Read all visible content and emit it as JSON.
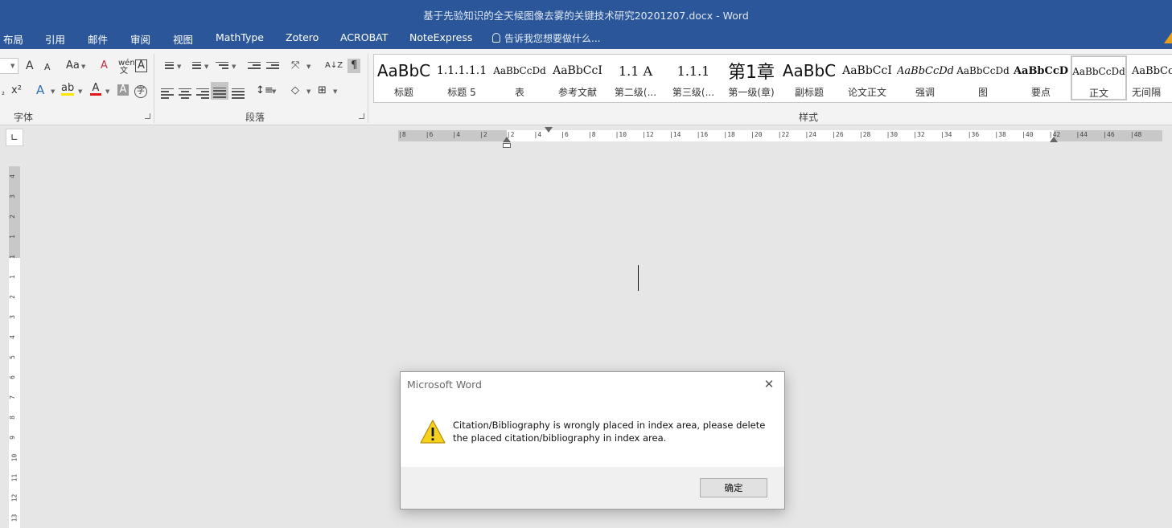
{
  "window": {
    "title": "基于先验知识的全天候图像去雾的关键技术研究20201207.docx - Word"
  },
  "tabs": [
    "布局",
    "引用",
    "邮件",
    "审阅",
    "视图",
    "MathType",
    "Zotero",
    "ACROBAT",
    "NoteExpress"
  ],
  "tell_me": "告诉我您想要做什么...",
  "ribbon": {
    "font_group": "字体",
    "paragraph_group": "段落",
    "styles_group": "样式",
    "font_icons": {
      "grow": "A",
      "shrink": "A",
      "case": "Aa",
      "clear": "A",
      "phonetic": "wén",
      "phonetic_char": "文",
      "border": "A",
      "sub": "₂",
      "sup": "x²",
      "effects": "A",
      "highlight": "ab",
      "font_color": "A",
      "shade": "A",
      "enclose": "字"
    },
    "para_icons": {
      "sort": "A↓Z",
      "marks": "¶"
    }
  },
  "styles": [
    {
      "sample": "AaBbC",
      "name": "标题"
    },
    {
      "sample": "1.1.1.1.1",
      "name": "标题 5"
    },
    {
      "sample": "AaBbCcDd",
      "name": "表"
    },
    {
      "sample": "AaBbCcI",
      "name": "参考文献"
    },
    {
      "sample": "1.1  A",
      "name": "第二级(..."
    },
    {
      "sample": "1.1.1",
      "name": "第三级(..."
    },
    {
      "sample": "第1章",
      "name": "第一级(章)"
    },
    {
      "sample": "AaBbC",
      "name": "副标题"
    },
    {
      "sample": "AaBbCcI",
      "name": "论文正文"
    },
    {
      "sample": "AaBbCcDd",
      "name": "强调"
    },
    {
      "sample": "AaBbCcDd",
      "name": "图"
    },
    {
      "sample": "AaBbCcD",
      "name": "要点"
    },
    {
      "sample": "AaBbCcDd",
      "name": "正文"
    },
    {
      "sample": "AaBbCcI",
      "name": "无间隔"
    }
  ],
  "ruler": {
    "h_ticks": [
      "8",
      "6",
      "4",
      "2",
      "2",
      "4",
      "6",
      "8",
      "10",
      "12",
      "14",
      "16",
      "18",
      "20",
      "22",
      "24",
      "26",
      "28",
      "30",
      "32",
      "34",
      "36",
      "38",
      "40",
      "42",
      "44",
      "46",
      "48"
    ],
    "v_ticks": [
      "4",
      "3",
      "2",
      "1",
      "1",
      "1",
      "2",
      "3",
      "4",
      "5",
      "6",
      "7",
      "8",
      "9",
      "10",
      "11",
      "12",
      "13"
    ]
  },
  "dialog": {
    "title": "Microsoft Word",
    "close": "✕",
    "message": "Citation/Bibliography is wrongly placed in index area, please delete the placed citation/bibliography in index area.",
    "ok": "确定"
  }
}
